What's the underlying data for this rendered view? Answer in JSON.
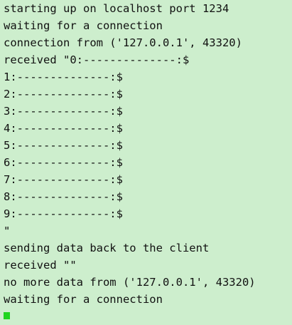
{
  "terminal": {
    "lines": [
      "starting up on localhost port 1234",
      "waiting for a connection",
      "connection from ('127.0.0.1', 43320)",
      "received \"0:--------------:$",
      "1:--------------:$",
      "2:--------------:$",
      "3:--------------:$",
      "4:--------------:$",
      "5:--------------:$",
      "6:--------------:$",
      "7:--------------:$",
      "8:--------------:$",
      "9:--------------:$",
      "\"",
      "sending data back to the client",
      "received \"\"",
      "no more data from ('127.0.0.1', 43320)",
      "waiting for a connection"
    ]
  },
  "colors": {
    "background": "#cdeecd",
    "text": "#111111",
    "cursor": "#1fd51f"
  }
}
